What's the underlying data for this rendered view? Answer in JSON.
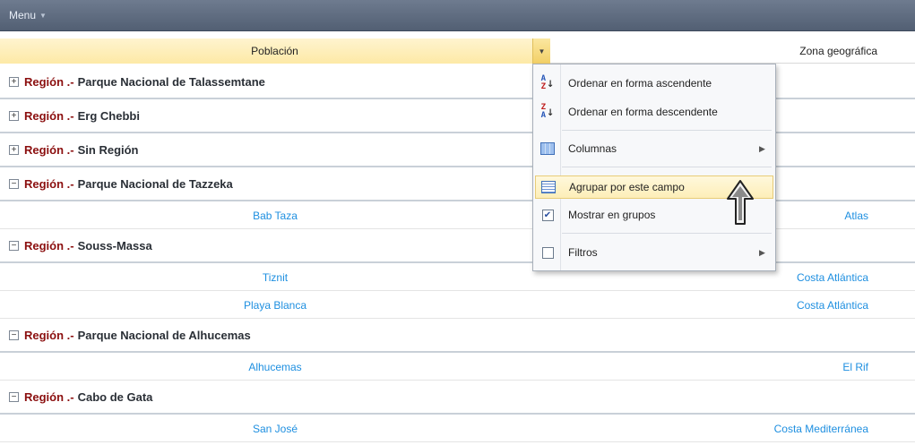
{
  "menubar": {
    "label": "Menu"
  },
  "header": {
    "col_poblacion": "Población",
    "col_zona": "Zona geográfica"
  },
  "group_prefix": "Región .-",
  "groups": [
    {
      "name": "Parque Nacional de Talassemtane",
      "expanded": false,
      "rows": []
    },
    {
      "name": "Erg Chebbi",
      "expanded": false,
      "rows": []
    },
    {
      "name": "Sin Región",
      "expanded": false,
      "rows": []
    },
    {
      "name": "Parque Nacional de Tazzeka",
      "expanded": true,
      "rows": [
        {
          "poblacion": "Bab Taza",
          "zona": "Atlas"
        }
      ]
    },
    {
      "name": "Souss-Massa",
      "expanded": true,
      "rows": [
        {
          "poblacion": "Tiznit",
          "zona": "Costa Atlántica"
        },
        {
          "poblacion": "Playa Blanca",
          "zona": "Costa Atlántica"
        }
      ]
    },
    {
      "name": "Parque Nacional de Alhucemas",
      "expanded": true,
      "rows": [
        {
          "poblacion": "Alhucemas",
          "zona": "El Rif"
        }
      ]
    },
    {
      "name": "Cabo de Gata",
      "expanded": true,
      "rows": [
        {
          "poblacion": "San José",
          "zona": "Costa Mediterránea"
        }
      ]
    }
  ],
  "context_menu": {
    "sort_asc": "Ordenar en forma ascendente",
    "sort_desc": "Ordenar en forma descendente",
    "columns": "Columnas",
    "group_by": "Agrupar por este campo",
    "show_groups": "Mostrar en grupos",
    "show_groups_checked": true,
    "filters": "Filtros",
    "filters_checked": false
  }
}
